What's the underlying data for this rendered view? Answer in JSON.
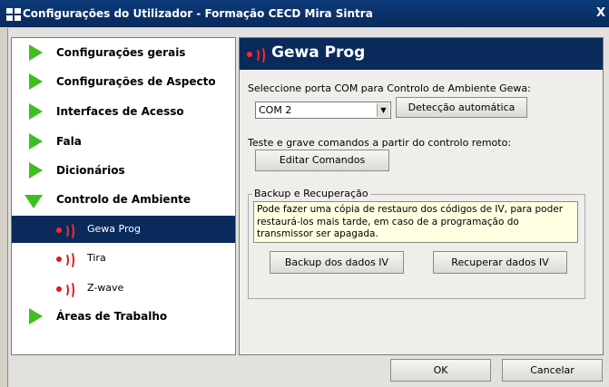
{
  "window": {
    "title": "Configurações do Utilizador - Formação CECD Mira Sintra",
    "close_label": "X"
  },
  "sidebar": {
    "items": [
      {
        "label": "Configurações gerais"
      },
      {
        "label": "Configurações de Aspecto"
      },
      {
        "label": "Interfaces de Acesso"
      },
      {
        "label": "Fala"
      },
      {
        "label": "Dicionários"
      },
      {
        "label": "Controlo de Ambiente"
      }
    ],
    "subitems": [
      {
        "label": "Gewa Prog",
        "selected": true
      },
      {
        "label": "Tira"
      },
      {
        "label": "Z-wave"
      }
    ],
    "last_item": {
      "label": "Áreas de Trabalho"
    }
  },
  "panel": {
    "title": "Gewa Prog",
    "com_label": "Seleccione porta COM para Controlo de Ambiente Gewa:",
    "com_value": "COM 2",
    "detect_button": "Detecção automática",
    "test_label": "Teste e grave comandos a partir do controlo remoto:",
    "edit_button": "Editar Comandos",
    "backup_group_title": "Backup e Recuperação",
    "backup_info": "Pode fazer uma cópia de restauro dos códigos de IV, para poder restaurá-los mais tarde, em caso de a programação do transmissor ser apagada.",
    "backup_button": "Backup dos dados IV",
    "restore_button": "Recuperar dados IV"
  },
  "footer": {
    "ok_button": "OK",
    "cancel_button": "Cancelar"
  },
  "colors": {
    "titlebar": "#0a2a5c",
    "selected": "#0a2a5c",
    "arrow_green": "#3fbf1f",
    "gewa_red": "#e8141c",
    "info_bg": "#ffffe1"
  },
  "icons": {
    "nav": "green-arrow-icon",
    "expanded": "green-arrow-down-icon",
    "gewa": "gewa-signal-icon",
    "app": "app-window-icon",
    "close": "close-icon"
  }
}
